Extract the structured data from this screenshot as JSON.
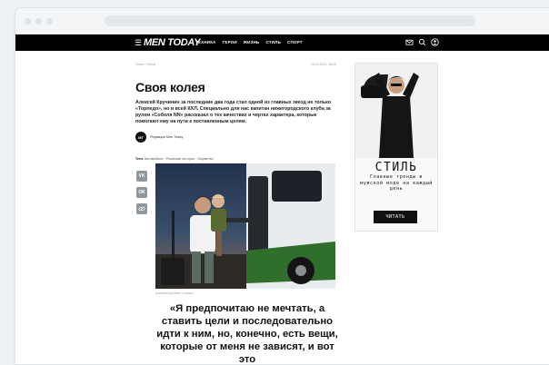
{
  "nav": {
    "logo": "MEN TODAY",
    "links": [
      "ТЕХНИКА",
      "ГЕРОИ",
      "ЖИЗНЬ",
      "СТИЛЬ",
      "СПОРТ"
    ]
  },
  "article": {
    "breadcrumb": "Спорт / Герои",
    "date": "18.03.2021, 18:00",
    "title": "Своя колея",
    "lead": "Алексей Кручинин за последние два года стал одной из главных звезд не только «Торпедо», но и всей КХЛ. Специально для нас капитан нижегородского клуба за рулем «Соболя NN» рассказал о тех качествах и чертах характера, которые помогают ему на пути к поставленным целям.",
    "author_initials": "MT",
    "author": "Редакция Men Today",
    "tags_label": "Теги:",
    "tags": "Автомобили · Реальные истории · Отцовство",
    "photo_caption": "Алексей Кручинин с сыном",
    "quote": "«Я предпочитаю не мечтать, а ставить цели и последовательно идти к ним, но, конечно, есть вещи, которые от меня не зависят, и вот это"
  },
  "share": {
    "vk": "VK",
    "ok": "OK"
  },
  "ad": {
    "title": "СТИЛЬ",
    "subtitle": "Главные тренды в мужской моде на каждый день",
    "button": "ЧИТАТЬ"
  }
}
